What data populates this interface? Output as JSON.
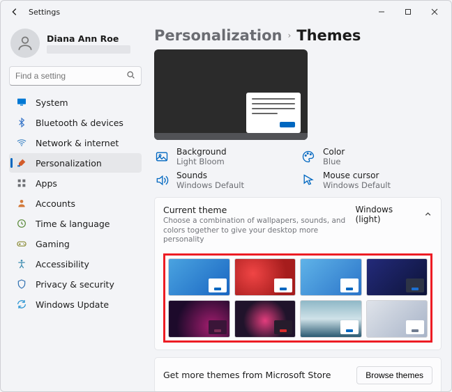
{
  "titlebar": {
    "title": "Settings"
  },
  "account": {
    "name": "Diana Ann Roe"
  },
  "search": {
    "placeholder": "Find a setting"
  },
  "nav": {
    "items": [
      {
        "label": "System",
        "icon": "monitor",
        "color": "#0078d4"
      },
      {
        "label": "Bluetooth & devices",
        "icon": "bluetooth",
        "color": "#3a77c9"
      },
      {
        "label": "Network & internet",
        "icon": "wifi",
        "color": "#3b82c4"
      },
      {
        "label": "Personalization",
        "icon": "brush",
        "color": "#d35c2a",
        "active": true
      },
      {
        "label": "Apps",
        "icon": "grid",
        "color": "#6d6f74"
      },
      {
        "label": "Accounts",
        "icon": "person",
        "color": "#d37a3b"
      },
      {
        "label": "Time & language",
        "icon": "clock",
        "color": "#5a8a3a"
      },
      {
        "label": "Gaming",
        "icon": "gamepad",
        "color": "#8a8a35"
      },
      {
        "label": "Accessibility",
        "icon": "accessibility",
        "color": "#3a8ab0"
      },
      {
        "label": "Privacy & security",
        "icon": "shield",
        "color": "#2f6fb0"
      },
      {
        "label": "Windows Update",
        "icon": "update",
        "color": "#1f8fd0"
      }
    ]
  },
  "breadcrumb": {
    "parent": "Personalization",
    "current": "Themes"
  },
  "theme_settings": {
    "background": {
      "label": "Background",
      "value": "Light Bloom"
    },
    "color": {
      "label": "Color",
      "value": "Blue"
    },
    "sounds": {
      "label": "Sounds",
      "value": "Windows Default"
    },
    "cursor": {
      "label": "Mouse cursor",
      "value": "Windows Default"
    }
  },
  "current_theme": {
    "title": "Current theme",
    "desc": "Choose a combination of wallpapers, sounds, and colors together to give your desktop more personality",
    "selected": "Windows (light)"
  },
  "themes": [
    {
      "bg": "linear-gradient(135deg,#4aa3e0 0%,#1a66c2 100%)",
      "mini_bg": "#ffffff",
      "mini_btn": "#0067c0"
    },
    {
      "bg": "radial-gradient(circle at 30% 40%, #f04545 0%, #a61d1d 70%)",
      "mini_bg": "#ffffff",
      "mini_btn": "#0067c0"
    },
    {
      "bg": "linear-gradient(135deg,#5fb3e8 0%,#2b74c9 100%)",
      "mini_bg": "#ffffff",
      "mini_btn": "#0067c0"
    },
    {
      "bg": "linear-gradient(135deg,#232a7a 0%,#0d1338 100%)",
      "mini_bg": "#2d3446",
      "mini_btn": "#1c6fd1"
    },
    {
      "bg": "radial-gradient(circle at 70% 70%, #a11d6d 0%, #1d0a2b 70%)",
      "mini_bg": "#3a1538",
      "mini_btn": "#7a2f56"
    },
    {
      "bg": "radial-gradient(circle at 50% 55%, #e33d7d 0%, #20132b 60%)",
      "mini_bg": "#261c2c",
      "mini_btn": "#d62b2b"
    },
    {
      "bg": "linear-gradient(180deg,#8fb8c7 0%,#cfe2e8 50%,#2a5a72 100%)",
      "mini_bg": "#ffffff",
      "mini_btn": "#0067c0"
    },
    {
      "bg": "linear-gradient(135deg,#dfe3ea 0%,#a8b4c8 100%)",
      "mini_bg": "#ffffff",
      "mini_btn": "#6f7c90"
    }
  ],
  "store": {
    "label": "Get more themes from Microsoft Store",
    "button": "Browse themes"
  }
}
